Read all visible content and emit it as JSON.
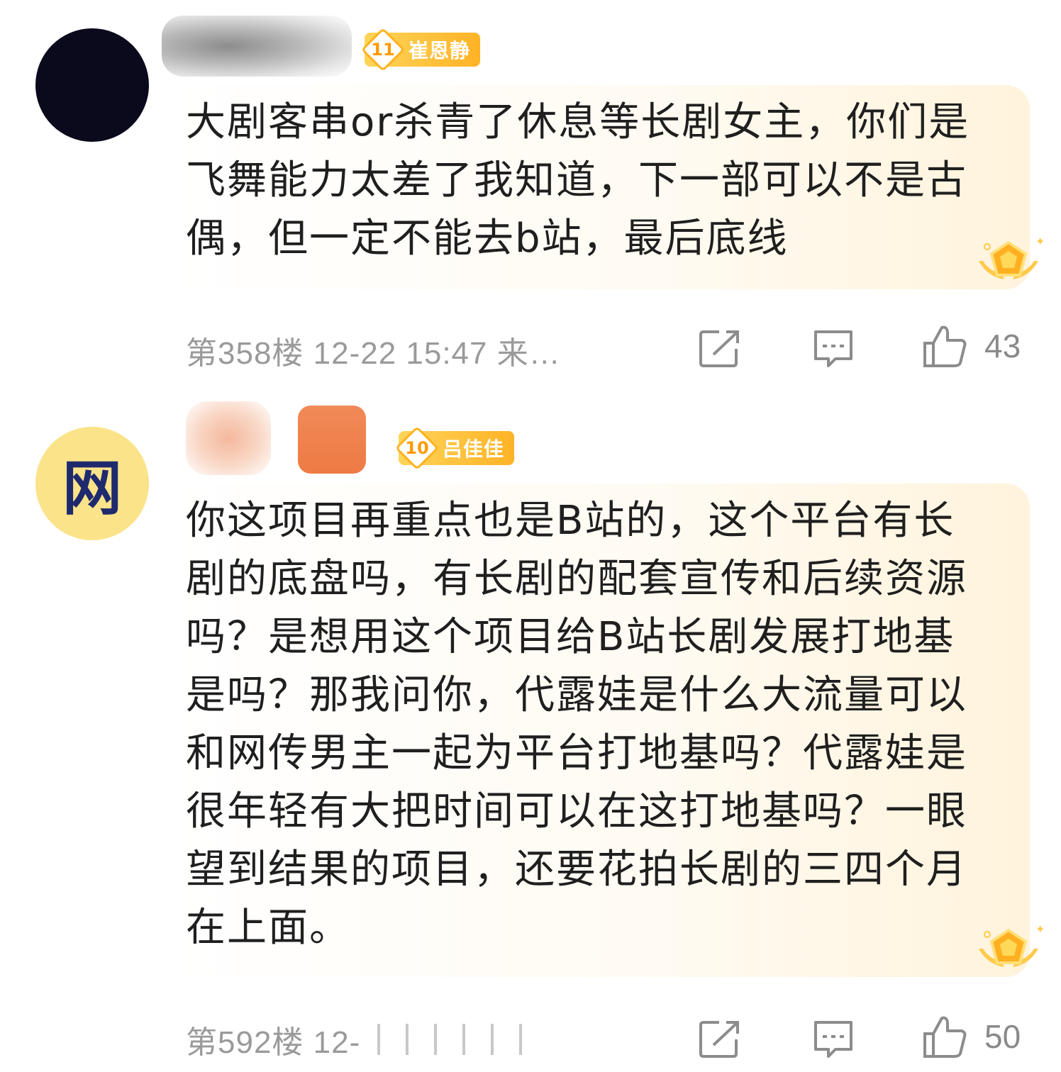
{
  "comments": [
    {
      "badge_level": "11",
      "badge_name": "崔恩静",
      "text": "大剧客串or杀青了休息等长剧女主，你们是飞舞能力太差了我知道，下一部可以不是古偶，但一定不能去b站，最后底线",
      "meta": "第358楼 12-22 15:47 来…",
      "likes": "43"
    },
    {
      "avatar_char": "网",
      "badge_level": "10",
      "badge_name": "吕佳佳",
      "text": "你这项目再重点也是B站的，这个平台有长剧的底盘吗，有长剧的配套宣传和后续资源吗？是想用这个项目给B站长剧发展打地基是吗？那我问你，代露娃是什么大流量可以和网传男主一起为平台打地基吗？代露娃是很年轻有大把时间可以在这打地基吗？一眼望到结果的项目，还要花拍长剧的三四个月在上面。",
      "meta": "第592楼 12-",
      "likes": "50"
    }
  ],
  "icons": {
    "share": "share-icon",
    "comment": "comment-icon",
    "like": "thumbs-up-icon",
    "medal": "medal-icon"
  },
  "colors": {
    "badge_gradient_start": "#ffd45a",
    "badge_gradient_end": "#ffb326",
    "bubble_tint": "#fff3dc",
    "meta_gray": "#9a9a9a"
  }
}
